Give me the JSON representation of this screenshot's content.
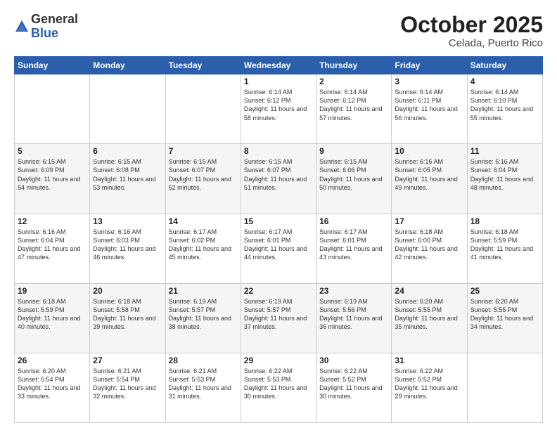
{
  "header": {
    "logo_general": "General",
    "logo_blue": "Blue",
    "month": "October 2025",
    "location": "Celada, Puerto Rico"
  },
  "weekdays": [
    "Sunday",
    "Monday",
    "Tuesday",
    "Wednesday",
    "Thursday",
    "Friday",
    "Saturday"
  ],
  "weeks": [
    [
      {
        "day": "",
        "info": ""
      },
      {
        "day": "",
        "info": ""
      },
      {
        "day": "",
        "info": ""
      },
      {
        "day": "1",
        "info": "Sunrise: 6:14 AM\nSunset: 6:12 PM\nDaylight: 11 hours\nand 58 minutes."
      },
      {
        "day": "2",
        "info": "Sunrise: 6:14 AM\nSunset: 6:12 PM\nDaylight: 11 hours\nand 57 minutes."
      },
      {
        "day": "3",
        "info": "Sunrise: 6:14 AM\nSunset: 6:11 PM\nDaylight: 11 hours\nand 56 minutes."
      },
      {
        "day": "4",
        "info": "Sunrise: 6:14 AM\nSunset: 6:10 PM\nDaylight: 11 hours\nand 55 minutes."
      }
    ],
    [
      {
        "day": "5",
        "info": "Sunrise: 6:15 AM\nSunset: 6:09 PM\nDaylight: 11 hours\nand 54 minutes."
      },
      {
        "day": "6",
        "info": "Sunrise: 6:15 AM\nSunset: 6:08 PM\nDaylight: 11 hours\nand 53 minutes."
      },
      {
        "day": "7",
        "info": "Sunrise: 6:15 AM\nSunset: 6:07 PM\nDaylight: 11 hours\nand 52 minutes."
      },
      {
        "day": "8",
        "info": "Sunrise: 6:15 AM\nSunset: 6:07 PM\nDaylight: 11 hours\nand 51 minutes."
      },
      {
        "day": "9",
        "info": "Sunrise: 6:15 AM\nSunset: 6:06 PM\nDaylight: 11 hours\nand 50 minutes."
      },
      {
        "day": "10",
        "info": "Sunrise: 6:16 AM\nSunset: 6:05 PM\nDaylight: 11 hours\nand 49 minutes."
      },
      {
        "day": "11",
        "info": "Sunrise: 6:16 AM\nSunset: 6:04 PM\nDaylight: 11 hours\nand 48 minutes."
      }
    ],
    [
      {
        "day": "12",
        "info": "Sunrise: 6:16 AM\nSunset: 6:04 PM\nDaylight: 11 hours\nand 47 minutes."
      },
      {
        "day": "13",
        "info": "Sunrise: 6:16 AM\nSunset: 6:03 PM\nDaylight: 11 hours\nand 46 minutes."
      },
      {
        "day": "14",
        "info": "Sunrise: 6:17 AM\nSunset: 6:02 PM\nDaylight: 11 hours\nand 45 minutes."
      },
      {
        "day": "15",
        "info": "Sunrise: 6:17 AM\nSunset: 6:01 PM\nDaylight: 11 hours\nand 44 minutes."
      },
      {
        "day": "16",
        "info": "Sunrise: 6:17 AM\nSunset: 6:01 PM\nDaylight: 11 hours\nand 43 minutes."
      },
      {
        "day": "17",
        "info": "Sunrise: 6:18 AM\nSunset: 6:00 PM\nDaylight: 11 hours\nand 42 minutes."
      },
      {
        "day": "18",
        "info": "Sunrise: 6:18 AM\nSunset: 5:59 PM\nDaylight: 11 hours\nand 41 minutes."
      }
    ],
    [
      {
        "day": "19",
        "info": "Sunrise: 6:18 AM\nSunset: 5:59 PM\nDaylight: 11 hours\nand 40 minutes."
      },
      {
        "day": "20",
        "info": "Sunrise: 6:18 AM\nSunset: 5:58 PM\nDaylight: 11 hours\nand 39 minutes."
      },
      {
        "day": "21",
        "info": "Sunrise: 6:19 AM\nSunset: 5:57 PM\nDaylight: 11 hours\nand 38 minutes."
      },
      {
        "day": "22",
        "info": "Sunrise: 6:19 AM\nSunset: 5:57 PM\nDaylight: 11 hours\nand 37 minutes."
      },
      {
        "day": "23",
        "info": "Sunrise: 6:19 AM\nSunset: 5:56 PM\nDaylight: 11 hours\nand 36 minutes."
      },
      {
        "day": "24",
        "info": "Sunrise: 6:20 AM\nSunset: 5:55 PM\nDaylight: 11 hours\nand 35 minutes."
      },
      {
        "day": "25",
        "info": "Sunrise: 6:20 AM\nSunset: 5:55 PM\nDaylight: 11 hours\nand 34 minutes."
      }
    ],
    [
      {
        "day": "26",
        "info": "Sunrise: 6:20 AM\nSunset: 5:54 PM\nDaylight: 11 hours\nand 33 minutes."
      },
      {
        "day": "27",
        "info": "Sunrise: 6:21 AM\nSunset: 5:54 PM\nDaylight: 11 hours\nand 32 minutes."
      },
      {
        "day": "28",
        "info": "Sunrise: 6:21 AM\nSunset: 5:53 PM\nDaylight: 11 hours\nand 31 minutes."
      },
      {
        "day": "29",
        "info": "Sunrise: 6:22 AM\nSunset: 5:53 PM\nDaylight: 11 hours\nand 30 minutes."
      },
      {
        "day": "30",
        "info": "Sunrise: 6:22 AM\nSunset: 5:52 PM\nDaylight: 11 hours\nand 30 minutes."
      },
      {
        "day": "31",
        "info": "Sunrise: 6:22 AM\nSunset: 5:52 PM\nDaylight: 11 hours\nand 29 minutes."
      },
      {
        "day": "",
        "info": ""
      }
    ]
  ]
}
